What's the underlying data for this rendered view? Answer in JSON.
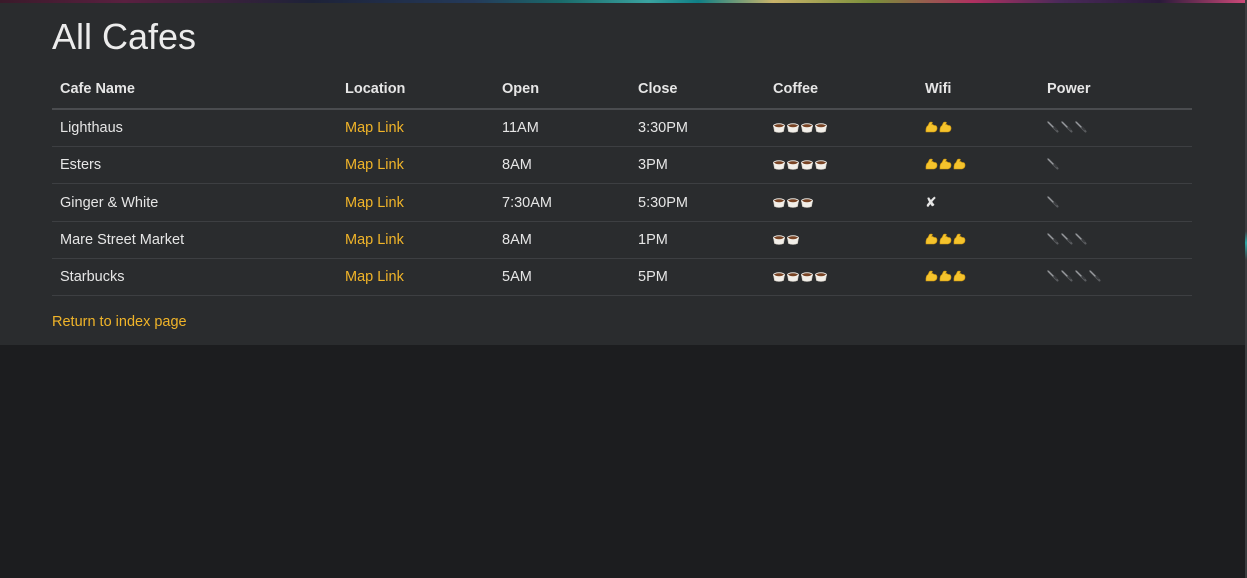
{
  "page": {
    "title": "All Cafes",
    "return_link": "Return to index page"
  },
  "table": {
    "headers": [
      "Cafe Name",
      "Location",
      "Open",
      "Close",
      "Coffee",
      "Wifi",
      "Power"
    ],
    "rows": [
      {
        "name": "Lighthaus",
        "location": "Map Link",
        "open": "11AM",
        "close": "3:30PM",
        "coffee": 4,
        "wifi": 2,
        "wifi_text": "",
        "power": 3
      },
      {
        "name": "Esters",
        "location": "Map Link",
        "open": "8AM",
        "close": "3PM",
        "coffee": 4,
        "wifi": 3,
        "wifi_text": "",
        "power": 1
      },
      {
        "name": "Ginger & White",
        "location": "Map Link",
        "open": "7:30AM",
        "close": "5:30PM",
        "coffee": 3,
        "wifi": 0,
        "wifi_text": "✘",
        "power": 1
      },
      {
        "name": "Mare Street Market",
        "location": "Map Link",
        "open": "8AM",
        "close": "1PM",
        "coffee": 2,
        "wifi": 3,
        "wifi_text": "",
        "power": 3
      },
      {
        "name": "Starbucks",
        "location": "Map Link",
        "open": "5AM",
        "close": "5PM",
        "coffee": 4,
        "wifi": 3,
        "wifi_text": "",
        "power": 4
      }
    ]
  },
  "icons": {
    "coffee": "coffee-cup-icon",
    "wifi": "flexed-biceps-icon",
    "power": "electric-plug-icon",
    "none": "cross-mark-icon"
  },
  "colors": {
    "link": "#f0b429",
    "panel": "#2a2c2e",
    "background": "#1c1d1f"
  }
}
